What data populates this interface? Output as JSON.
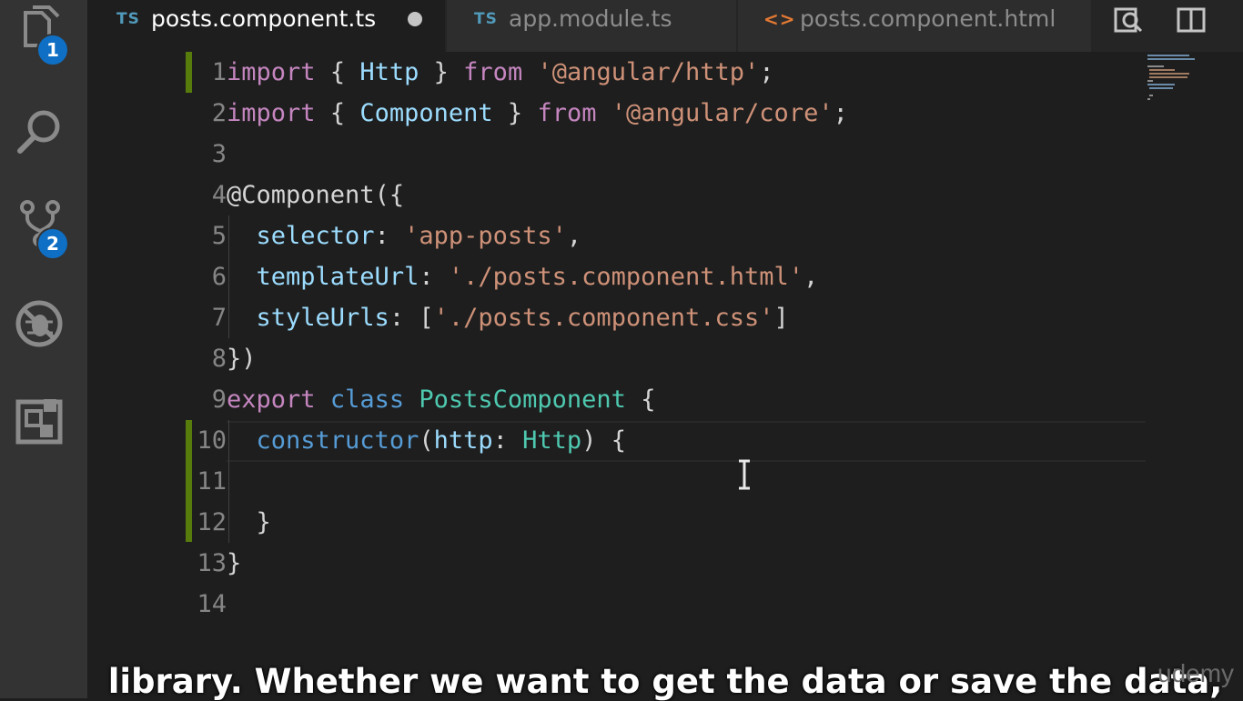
{
  "activity_bar": {
    "items": [
      {
        "name": "explorer-icon",
        "badge": "1"
      },
      {
        "name": "search-icon"
      },
      {
        "name": "source-control-icon",
        "badge": "2"
      },
      {
        "name": "debug-icon"
      },
      {
        "name": "extensions-icon"
      }
    ]
  },
  "tabs": [
    {
      "type": "TS",
      "label": "posts.component.ts",
      "active": true,
      "dirty": true
    },
    {
      "type": "TS",
      "label": "app.module.ts",
      "active": false
    },
    {
      "type": "<>",
      "label": "posts.component.html",
      "active": false
    }
  ],
  "tab_actions": [
    "split-editor-search-icon",
    "split-editor-icon"
  ],
  "editor": {
    "line_numbers": [
      "1",
      "2",
      "3",
      "4",
      "5",
      "6",
      "7",
      "8",
      "9",
      "10",
      "11",
      "12",
      "13",
      "14"
    ],
    "lines": [
      "import { Http } from '@angular/http';",
      "import { Component } from '@angular/core';",
      "",
      "@Component({",
      "  selector: 'app-posts',",
      "  templateUrl: './posts.component.html',",
      "  styleUrls: ['./posts.component.css']",
      "})",
      "export class PostsComponent {",
      "  constructor(http: Http) {",
      "",
      "  }",
      "}",
      ""
    ]
  },
  "subtitle": "library. Whether we want to get the data or save the data,",
  "watermark": "udemy",
  "colors": {
    "background": "#1e1e1e",
    "activity_bar": "#333333",
    "badge": "#0e6fc4",
    "keyword": "#c586c0",
    "string": "#ce9178",
    "type": "#4ec9b0",
    "identifier": "#9cdcfe"
  }
}
